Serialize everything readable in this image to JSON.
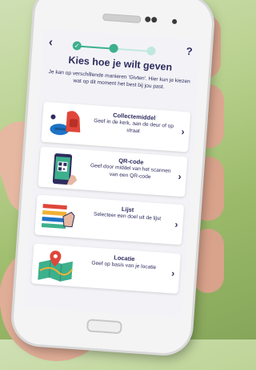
{
  "nav": {
    "back_icon": "chevron-left-icon",
    "back_glyph": "‹",
    "help_label": "?",
    "progress": {
      "steps_total": 3,
      "completed": 1,
      "current": 2
    },
    "done_glyph": "✓"
  },
  "header": {
    "title": "Kies hoe je wilt geven",
    "subtitle": "Je kan op verschillende manieren 'Givten'. Hier kun je kiezen wat op dit moment het best bij jou past."
  },
  "options": [
    {
      "title": "Collectemiddel",
      "description": "Geef in de kerk, aan de deur of op straat",
      "icon": "collection-bag-icon"
    },
    {
      "title": "QR-code",
      "description": "Geef door middel van het scannen van een QR-code",
      "icon": "qr-phone-icon"
    },
    {
      "title": "Lijst",
      "description": "Selecteer een doel uit de lijst",
      "icon": "list-hand-icon"
    },
    {
      "title": "Locatie",
      "description": "Geef op basis van je locatie",
      "icon": "map-pin-icon"
    }
  ],
  "chevron_glyph": "›",
  "colors": {
    "accent": "#3db08c",
    "accent_light": "#bfe9dc",
    "text": "#2e2c5e"
  }
}
